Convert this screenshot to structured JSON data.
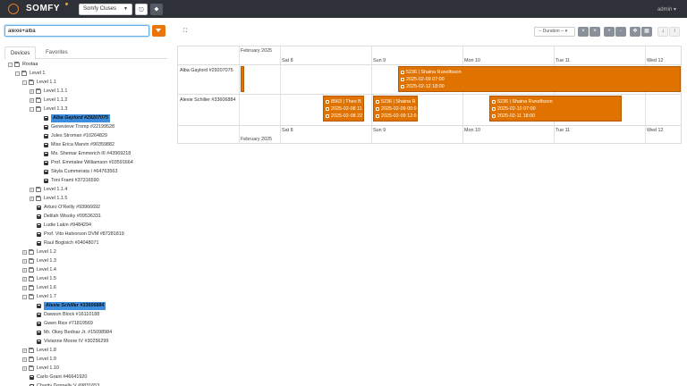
{
  "header": {
    "brand": "SOMFY",
    "project_select": "Somfy Cluses",
    "user": "admin",
    "colors": {
      "topbar": "#2e3238",
      "accent": "#e87a20"
    }
  },
  "left": {
    "search_value": "alexie+alba",
    "tabs": [
      "Devices",
      "Favorites"
    ],
    "tree": [
      {
        "label": "Rootaa",
        "depth": 0,
        "type": "folder",
        "toggle": "-"
      },
      {
        "label": "Level 1",
        "depth": 1,
        "type": "folder",
        "toggle": "-"
      },
      {
        "label": "Level 1.1",
        "depth": 2,
        "type": "folder",
        "toggle": "-"
      },
      {
        "label": "Level 1.1.1",
        "depth": 3,
        "type": "folder",
        "toggle": "+"
      },
      {
        "label": "Level 1.1.2",
        "depth": 3,
        "type": "folder",
        "toggle": "+"
      },
      {
        "label": "Level 1.1.3",
        "depth": 3,
        "type": "folder",
        "toggle": "-"
      },
      {
        "label": "Alba Gaylord #29207075",
        "depth": 4,
        "type": "device",
        "highlight": true
      },
      {
        "label": "Genevieve Tromp #22199528",
        "depth": 4,
        "type": "device"
      },
      {
        "label": "Jules Stroman #10264829",
        "depth": 4,
        "type": "device"
      },
      {
        "label": "Miss Erica Marvin #90359882",
        "depth": 4,
        "type": "device"
      },
      {
        "label": "Ms. Shemar Emmerich III #43969218",
        "depth": 4,
        "type": "device"
      },
      {
        "label": "Prof. Emmalee Williamson #03591664",
        "depth": 4,
        "type": "device"
      },
      {
        "label": "Skyla Cummerata I #64763563",
        "depth": 4,
        "type": "device"
      },
      {
        "label": "Toni Frami #37316590",
        "depth": 4,
        "type": "device"
      },
      {
        "label": "Level 1.1.4",
        "depth": 3,
        "type": "folder",
        "toggle": "+"
      },
      {
        "label": "Level 1.1.5",
        "depth": 3,
        "type": "folder",
        "toggle": "+"
      },
      {
        "label": "Arturo O'Reilly #93966692",
        "depth": 3,
        "type": "device"
      },
      {
        "label": "Delilah Wisoky #09536331",
        "depth": 3,
        "type": "device"
      },
      {
        "label": "Ludie Lakin #9484294",
        "depth": 3,
        "type": "device"
      },
      {
        "label": "Prof. Vito Halvorson DVM #87281819",
        "depth": 3,
        "type": "device"
      },
      {
        "label": "Raul Bogisich #04048071",
        "depth": 3,
        "type": "device"
      },
      {
        "label": "Level 1.2",
        "depth": 2,
        "type": "folder",
        "toggle": "+"
      },
      {
        "label": "Level 1.3",
        "depth": 2,
        "type": "folder",
        "toggle": "+"
      },
      {
        "label": "Level 1.4",
        "depth": 2,
        "type": "folder",
        "toggle": "+"
      },
      {
        "label": "Level 1.5",
        "depth": 2,
        "type": "folder",
        "toggle": "+"
      },
      {
        "label": "Level 1.6",
        "depth": 2,
        "type": "folder",
        "toggle": "+"
      },
      {
        "label": "Level 1.7",
        "depth": 2,
        "type": "folder",
        "toggle": "-"
      },
      {
        "label": "Alexie Schiller #33606884",
        "depth": 3,
        "type": "device",
        "highlight": true
      },
      {
        "label": "Dawson Block #16110188",
        "depth": 3,
        "type": "device"
      },
      {
        "label": "Gwen Rice #71819569",
        "depth": 3,
        "type": "device"
      },
      {
        "label": "Mr. Okey Bednar Jr. #15098984",
        "depth": 3,
        "type": "device"
      },
      {
        "label": "Vivianne Moore IV #30256299",
        "depth": 3,
        "type": "device"
      },
      {
        "label": "Level 1.8",
        "depth": 2,
        "type": "folder",
        "toggle": "+"
      },
      {
        "label": "Level 1.9",
        "depth": 2,
        "type": "folder",
        "toggle": "+"
      },
      {
        "label": "Level 1.10",
        "depth": 2,
        "type": "folder",
        "toggle": "+"
      },
      {
        "label": "Carlo Grant #46641920",
        "depth": 2,
        "type": "device"
      },
      {
        "label": "Charity Donnelly V #9831653",
        "depth": 2,
        "type": "device"
      }
    ]
  },
  "toolbar": {
    "expand_icon": "expand-icon",
    "duration_placeholder": "-- Duration --",
    "buttons": [
      "×",
      "×",
      "+",
      "-",
      "✥",
      "▦",
      "↓",
      "↑"
    ]
  },
  "timeline": {
    "month": "February 2025",
    "days": [
      "Sat 8",
      "Sun 9",
      "Mon 10",
      "Tue 11",
      "Wed 12"
    ],
    "groups": [
      {
        "name": "Alba Gaylord #29207075",
        "items": [
          {
            "lines": [
              "",
              "",
              ""
            ],
            "narrow": true
          },
          {
            "lines": [
              "5236  |  Shaina Runolfsson",
              "2025-02-09 07:00",
              "2025-02-12 18:00"
            ]
          }
        ]
      },
      {
        "name": "Alexie Schiller #33606884",
        "items": [
          {
            "lines": [
              "8563  |  Theo B",
              "2025-02-08 11",
              "2025-02-08 22"
            ]
          },
          {
            "lines": [
              "5236  |  Shaina R",
              "2025-02-09 00:0",
              "2025-02-09 12:0"
            ]
          },
          {
            "lines": [
              "5236  |  Shaina Runolfsson",
              "2025-02-10 07:00",
              "2025-02-11 18:00"
            ]
          }
        ]
      }
    ]
  }
}
